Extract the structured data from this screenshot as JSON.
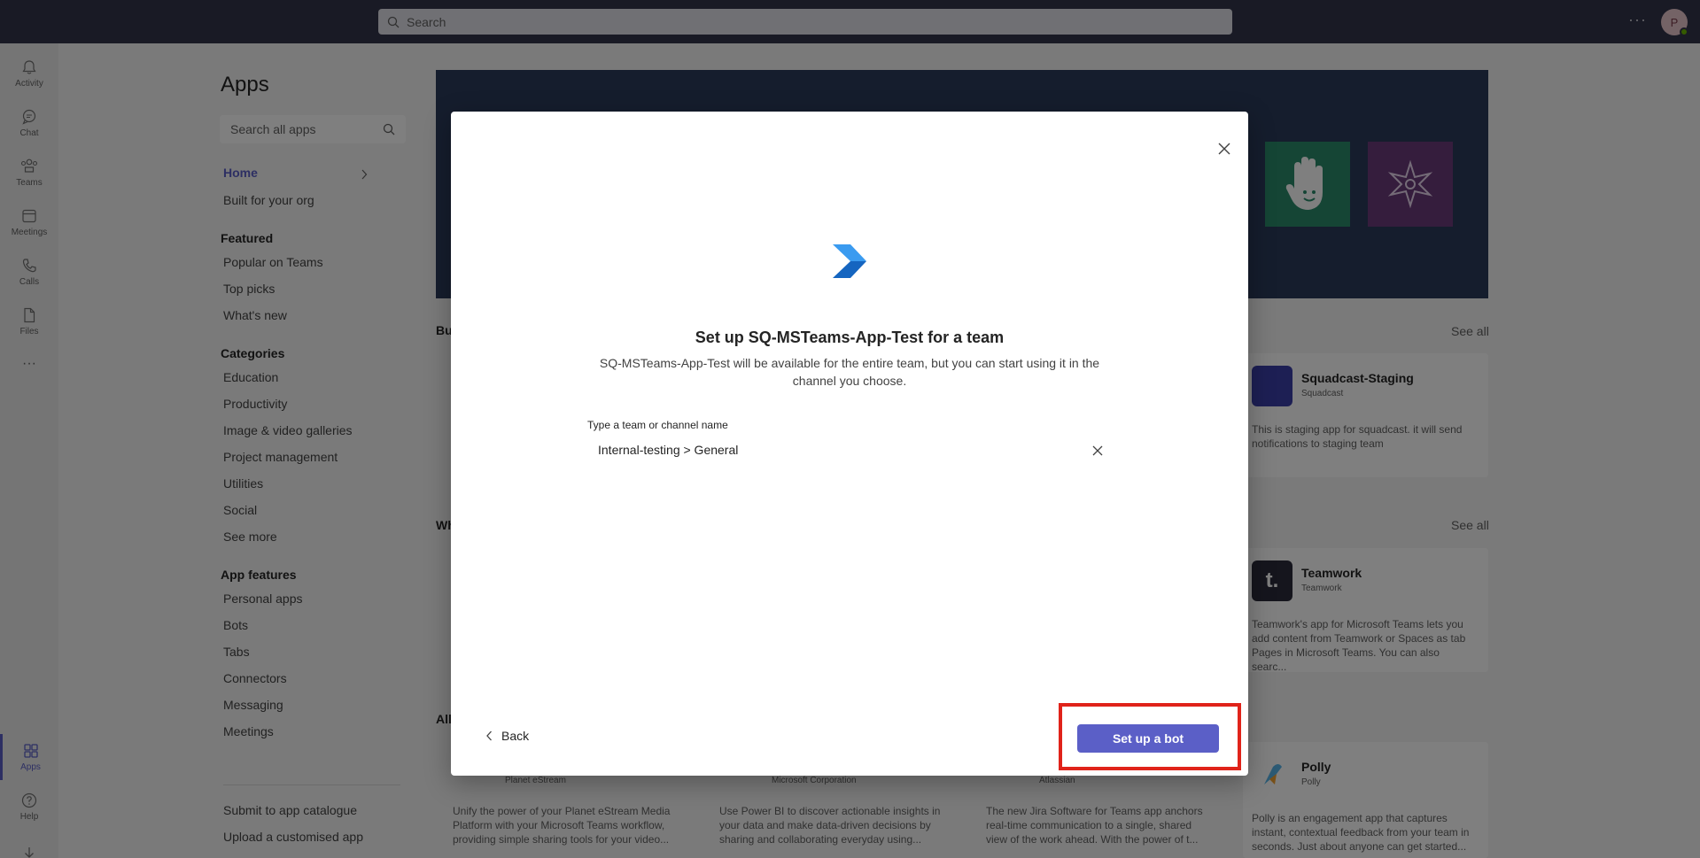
{
  "topbar": {
    "search_placeholder": "Search",
    "more_label": "···",
    "avatar_initial": "P"
  },
  "rail": {
    "items": [
      {
        "label": "Activity",
        "icon": "bell-icon"
      },
      {
        "label": "Chat",
        "icon": "chat-icon"
      },
      {
        "label": "Teams",
        "icon": "teams-icon"
      },
      {
        "label": "Meetings",
        "icon": "calendar-icon"
      },
      {
        "label": "Calls",
        "icon": "phone-icon"
      },
      {
        "label": "Files",
        "icon": "file-icon"
      },
      {
        "label": "···",
        "icon": "more-icon"
      },
      {
        "label": "Apps",
        "icon": "apps-icon"
      },
      {
        "label": "Help",
        "icon": "help-icon"
      },
      {
        "label": "",
        "icon": "download-icon"
      }
    ]
  },
  "apps_nav": {
    "title": "Apps",
    "search_placeholder": "Search all apps",
    "home": "Home",
    "built_for_org": "Built for your org",
    "featured_heading": "Featured",
    "featured": [
      "Popular on Teams",
      "Top picks",
      "What's new"
    ],
    "categories_heading": "Categories",
    "categories": [
      "Education",
      "Productivity",
      "Image & video galleries",
      "Project management",
      "Utilities",
      "Social",
      "See more"
    ],
    "features_heading": "App features",
    "features": [
      "Personal apps",
      "Bots",
      "Tabs",
      "Connectors",
      "Messaging",
      "Meetings"
    ],
    "footer": [
      "Submit to app catalogue",
      "Upload a customised app"
    ]
  },
  "background": {
    "see_all": "See all",
    "section_prefixes": [
      "Bu",
      "Wh",
      "All"
    ],
    "cards": [
      {
        "title": "Squadcast-Staging",
        "publisher": "Squadcast",
        "desc": "This is staging app for squadcast. it will send notifications to staging team",
        "color": "#3b3fa8"
      },
      {
        "title": "Teamwork",
        "publisher": "Teamwork",
        "desc": "Teamwork's app for Microsoft Teams lets you add content from Teamwork or Spaces as tab Pages in Microsoft Teams. You can also searc...",
        "color": "#2a2a3a"
      }
    ],
    "bottom": [
      {
        "publisher": "Planet eStream",
        "desc": "Unify the power of your Planet eStream Media Platform with your Microsoft Teams workflow, providing simple sharing tools for your video..."
      },
      {
        "publisher": "Microsoft Corporation",
        "desc": "Use Power BI to discover actionable insights in your data and make data-driven decisions by sharing and collaborating everyday using..."
      },
      {
        "publisher": "Atlassian",
        "desc": "The new Jira Software for Teams app anchors real-time communication to a single, shared view of the work ahead. With the power of t..."
      },
      {
        "title": "Polly",
        "publisher": "Polly",
        "desc": "Polly is an engagement app that captures instant, contextual feedback from your team in seconds. Just about anyone can get started..."
      }
    ]
  },
  "dialog": {
    "title": "Set up SQ-MSTeams-App-Test for a team",
    "description": "SQ-MSTeams-App-Test will be available for the entire team, but you can start using it in the channel you choose.",
    "field_label": "Type a team or channel name",
    "field_value": "Internal-testing > General",
    "back_label": "Back",
    "primary_label": "Set up a bot"
  },
  "colors": {
    "accent": "#5b5fc7",
    "topbar": "#33344a",
    "highlight": "#e0231a"
  }
}
